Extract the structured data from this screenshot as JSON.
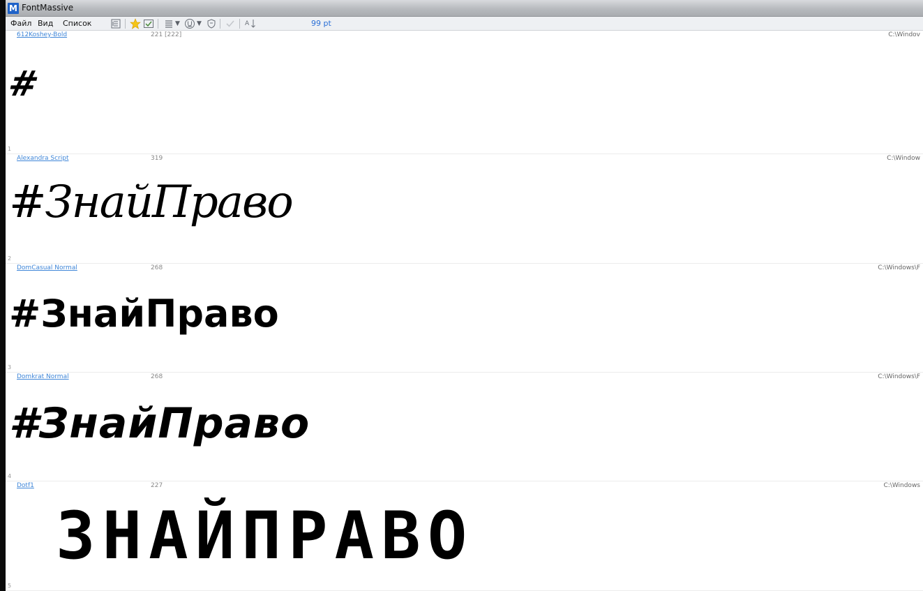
{
  "window": {
    "title": "FontMassive",
    "app_icon_letter": "M"
  },
  "menu": {
    "items": [
      "Файл",
      "Вид",
      "Список"
    ]
  },
  "toolbar": {
    "size_label": "99 pt"
  },
  "fonts": [
    {
      "name": "612Koshey-Bold",
      "glyphs": "221 [222]",
      "path": "C:\\Windov",
      "index": "1",
      "sample": "#"
    },
    {
      "name": "Alexandra Script",
      "glyphs": "319",
      "path": "C:\\Window",
      "index": "2",
      "sample": "#ЗнайПраво"
    },
    {
      "name": "DomCasual Normal",
      "glyphs": "268",
      "path": "C:\\Windows\\F",
      "index": "3",
      "sample": "#ЗнайПраво"
    },
    {
      "name": "Domkrat Normal",
      "glyphs": "268",
      "path": "C:\\Windows\\F",
      "index": "4",
      "sample": "#ЗнайПраво"
    },
    {
      "name": "Dotf1",
      "glyphs": "227",
      "path": "C:\\Windows",
      "index": "5",
      "sample": "ЗНАЙПРАВО"
    }
  ]
}
